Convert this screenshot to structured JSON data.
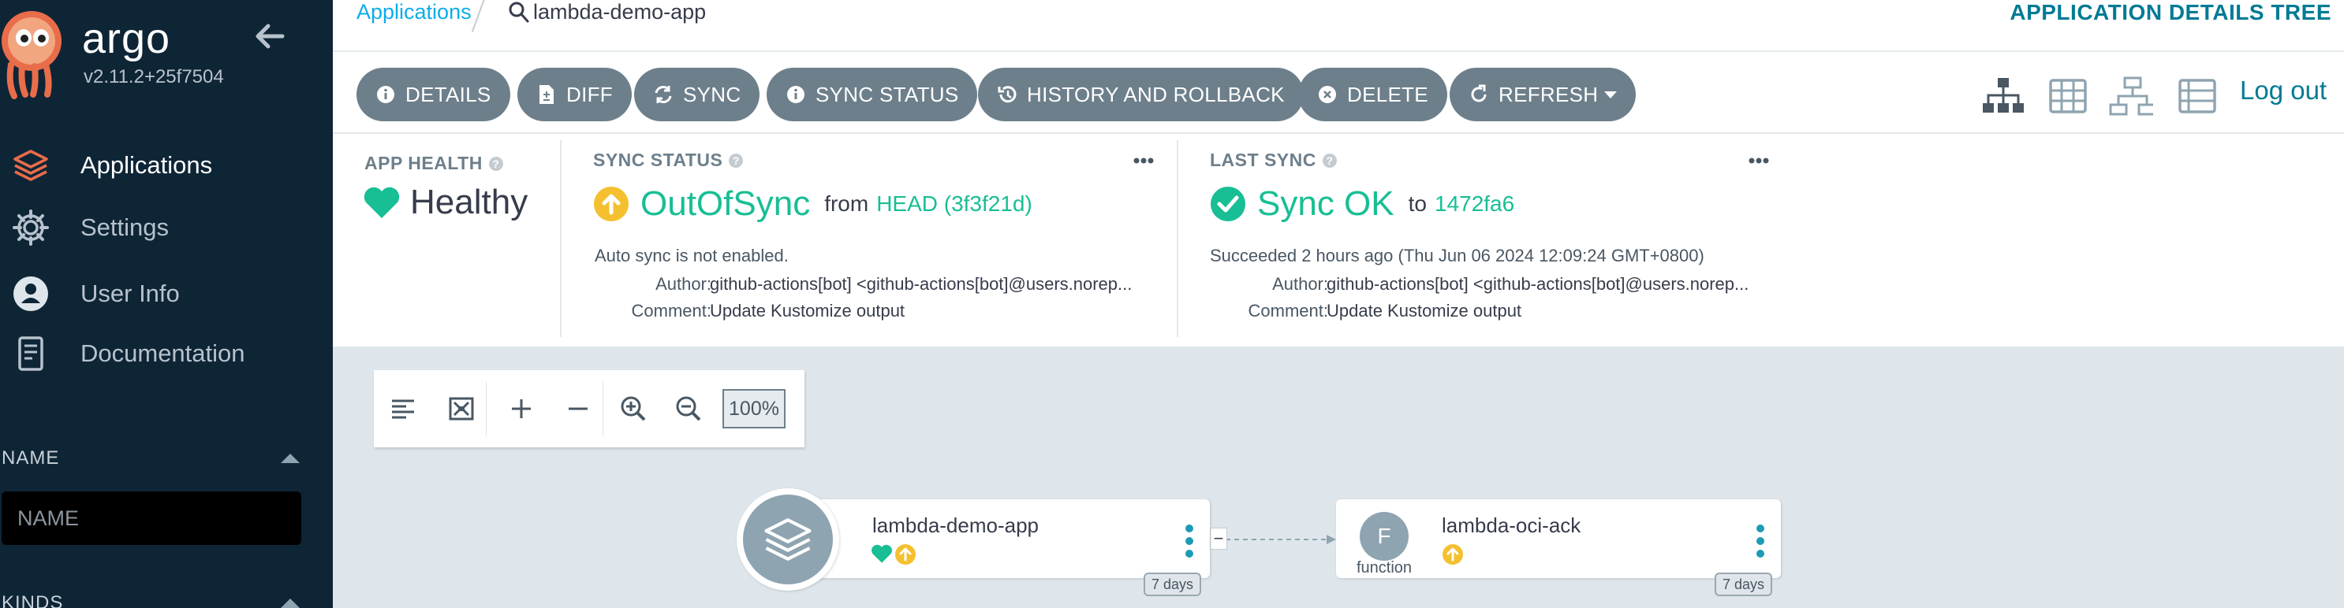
{
  "sidebar": {
    "brand": "argo",
    "version": "v2.11.2+25f7504",
    "nav": [
      {
        "label": "Applications",
        "icon": "layers-icon"
      },
      {
        "label": "Settings",
        "icon": "gear-icon"
      },
      {
        "label": "User Info",
        "icon": "user-icon"
      },
      {
        "label": "Documentation",
        "icon": "book-icon"
      }
    ],
    "filters": {
      "name_label": "NAME",
      "name_placeholder": "NAME",
      "kinds_label": "KINDS"
    }
  },
  "topbar": {
    "breadcrumb_link": "Applications",
    "current_app": "lambda-demo-app",
    "page_title": "APPLICATION DETAILS TREE"
  },
  "toolbar": {
    "buttons": [
      {
        "label": "DETAILS",
        "icon": "info-icon"
      },
      {
        "label": "DIFF",
        "icon": "file-diff-icon"
      },
      {
        "label": "SYNC",
        "icon": "sync-icon"
      },
      {
        "label": "SYNC STATUS",
        "icon": "info-icon"
      },
      {
        "label": "HISTORY AND ROLLBACK",
        "icon": "history-icon"
      },
      {
        "label": "DELETE",
        "icon": "close-circle-icon"
      },
      {
        "label": "REFRESH",
        "icon": "refresh-icon"
      }
    ],
    "views": [
      "tree-view-icon",
      "pods-grid-icon",
      "network-view-icon",
      "list-view-icon"
    ],
    "logout": "Log out"
  },
  "status": {
    "health": {
      "title": "APP HEALTH",
      "value": "Healthy",
      "color": "#18be94"
    },
    "sync": {
      "title": "SYNC STATUS",
      "value": "OutOfSync",
      "from_text": "from",
      "revision": "HEAD (3f3f21d)",
      "auto_sync": "Auto sync is not enabled.",
      "author_label": "Author:",
      "author": "github-actions[bot] <github-actions[bot]@users.norep...",
      "comment_label": "Comment:",
      "comment": "Update Kustomize output",
      "color": "#f4c030"
    },
    "last_sync": {
      "title": "LAST SYNC",
      "value": "Sync OK",
      "to_text": "to",
      "revision": "1472fa6",
      "succeeded": "Succeeded 2 hours ago (Thu Jun 06 2024 12:09:24 GMT+0800)",
      "author_label": "Author:",
      "author": "github-actions[bot] <github-actions[bot]@users.norep...",
      "comment_label": "Comment:",
      "comment": "Update Kustomize output",
      "color": "#18be94"
    }
  },
  "canvas": {
    "zoom": "100%",
    "nodes": [
      {
        "name": "lambda-demo-app",
        "age": "7 days",
        "kind_icon": "layers-icon"
      },
      {
        "name": "lambda-oci-ack",
        "kind_letter": "F",
        "kind_label": "function",
        "age": "7 days"
      }
    ],
    "collapse_symbol": "−"
  }
}
